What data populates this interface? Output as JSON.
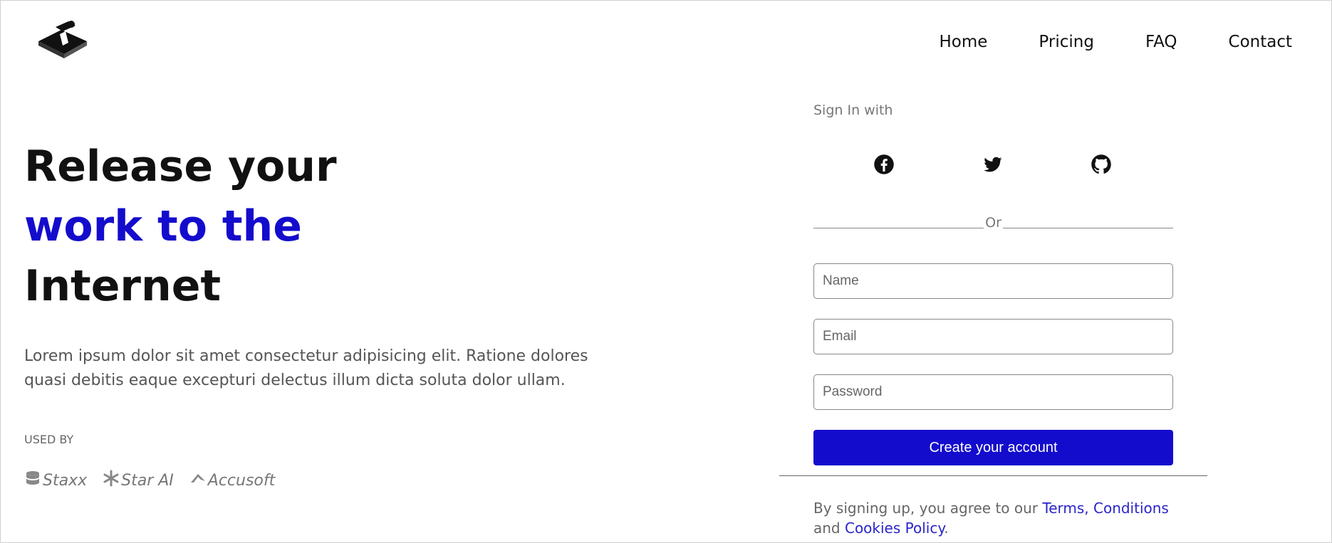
{
  "header": {
    "logo_icon": "isometric-figure-logo",
    "nav": [
      {
        "label": "Home"
      },
      {
        "label": "Pricing"
      },
      {
        "label": "FAQ"
      },
      {
        "label": "Contact"
      }
    ]
  },
  "hero": {
    "headline_line1": "Release your",
    "headline_line2": "work to the",
    "headline_line3": "Internet",
    "accent_color": "#140ccc",
    "description": "Lorem ipsum dolor sit amet consectetur adipisicing elit. Ratione dolores quasi debitis eaque excepturi delectus illum dicta soluta dolor ullam."
  },
  "used_by": {
    "label": "USED BY",
    "brands": [
      {
        "name": "Staxx",
        "icon": "database-icon"
      },
      {
        "name": "Star AI",
        "icon": "asterisk-icon"
      },
      {
        "name": "Accusoft",
        "icon": "accusoft-icon"
      }
    ]
  },
  "signup": {
    "signin_label": "Sign In with",
    "socials": [
      {
        "icon": "facebook-icon"
      },
      {
        "icon": "twitter-icon"
      },
      {
        "icon": "github-icon"
      }
    ],
    "or_label": "Or",
    "name_placeholder": "Name",
    "email_placeholder": "Email",
    "password_placeholder": "Password",
    "submit_label": "Create your account",
    "button_color": "#140ccc"
  },
  "terms": {
    "prefix": "By signing up, you agree to our ",
    "terms_link": "Terms, Conditions",
    "and": " and ",
    "cookies_link": "Cookies Policy",
    "suffix": "."
  }
}
